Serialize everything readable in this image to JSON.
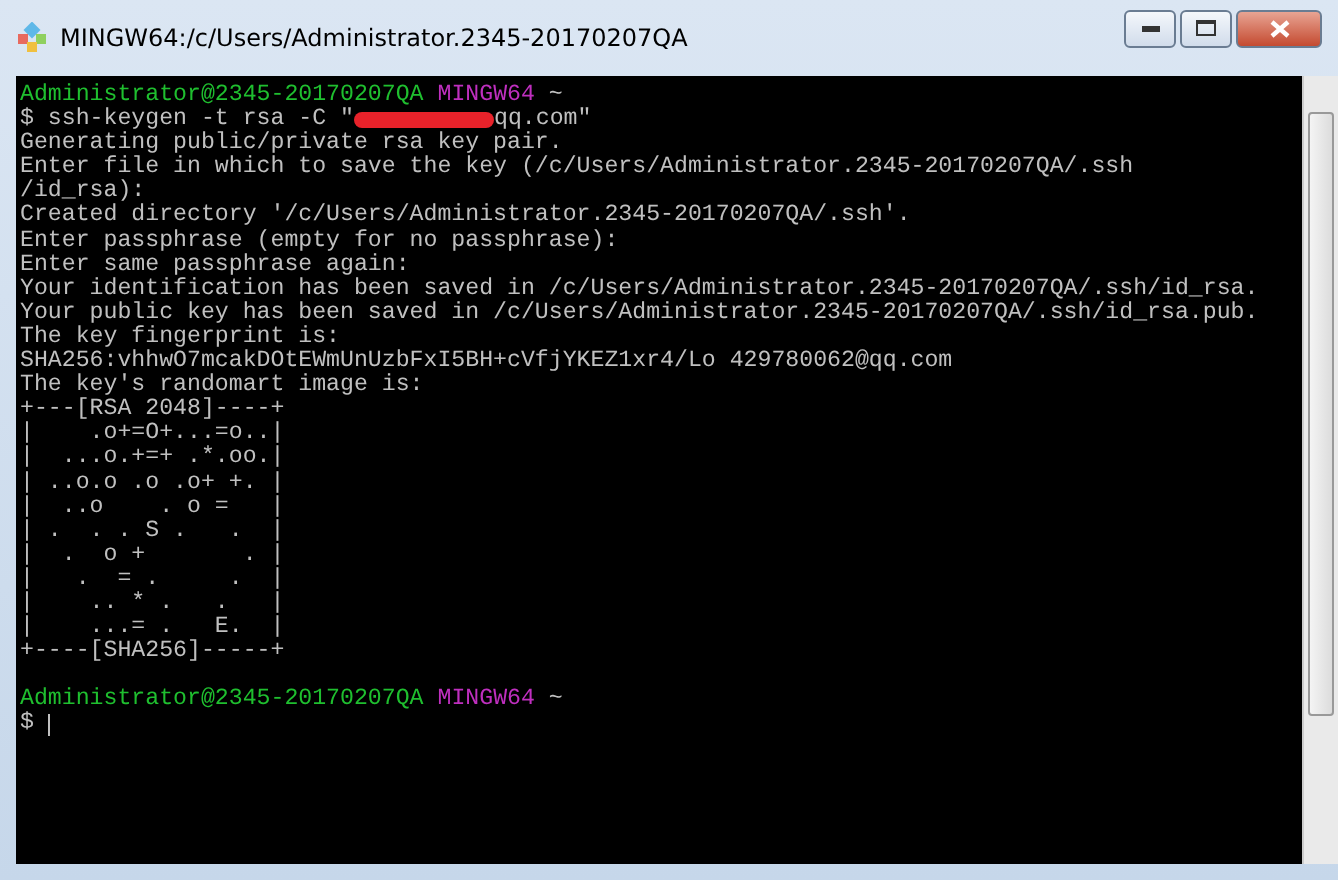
{
  "window": {
    "title": "MINGW64:/c/Users/Administrator.2345-20170207QA"
  },
  "terminal": {
    "lines": [
      {
        "kind": "prompt",
        "user": "Administrator@2345-20170207QA",
        "shell": "MINGW64",
        "path": "~"
      },
      {
        "kind": "command",
        "before": "$ ssh-keygen -t rsa -C \"",
        "redacted": true,
        "after": "qq.com\""
      },
      {
        "kind": "output",
        "text": "Generating public/private rsa key pair."
      },
      {
        "kind": "output",
        "text": "Enter file in which to save the key (/c/Users/Administrator.2345-20170207QA/.ssh"
      },
      {
        "kind": "output",
        "text": "/id_rsa):"
      },
      {
        "kind": "output",
        "text": "Created directory '/c/Users/Administrator.2345-20170207QA/.ssh'."
      },
      {
        "kind": "output",
        "text": "Enter passphrase (empty for no passphrase):"
      },
      {
        "kind": "output",
        "text": "Enter same passphrase again:"
      },
      {
        "kind": "output",
        "text": "Your identification has been saved in /c/Users/Administrator.2345-20170207QA/.ssh/id_rsa."
      },
      {
        "kind": "output",
        "text": "Your public key has been saved in /c/Users/Administrator.2345-20170207QA/.ssh/id_rsa.pub."
      },
      {
        "kind": "output",
        "text": "The key fingerprint is:"
      },
      {
        "kind": "output",
        "text": "SHA256:vhhwO7mcakDOtEWmUnUzbFxI5BH+cVfjYKEZ1xr4/Lo 429780062@qq.com"
      },
      {
        "kind": "output",
        "text": "The key's randomart image is:"
      },
      {
        "kind": "output",
        "text": "+---[RSA 2048]----+"
      },
      {
        "kind": "output",
        "text": "|    .o+=O+...=o..|"
      },
      {
        "kind": "output",
        "text": "|  ...o.+=+ .*.oo.|"
      },
      {
        "kind": "output",
        "text": "| ..o.o .o .o+ +. |"
      },
      {
        "kind": "output",
        "text": "|  ..o    . o =   |"
      },
      {
        "kind": "output",
        "text": "| .  . . S .   .  |"
      },
      {
        "kind": "output",
        "text": "|  .  o +       . |"
      },
      {
        "kind": "output",
        "text": "|   .  = .     .  |"
      },
      {
        "kind": "output",
        "text": "|    .. * .   .   |"
      },
      {
        "kind": "output",
        "text": "|    ...= .   E.  |"
      },
      {
        "kind": "output",
        "text": "+----[SHA256]-----+"
      },
      {
        "kind": "blank"
      },
      {
        "kind": "prompt",
        "user": "Administrator@2345-20170207QA",
        "shell": "MINGW64",
        "path": "~"
      },
      {
        "kind": "input",
        "text": "$ ",
        "cursor": true
      }
    ]
  }
}
